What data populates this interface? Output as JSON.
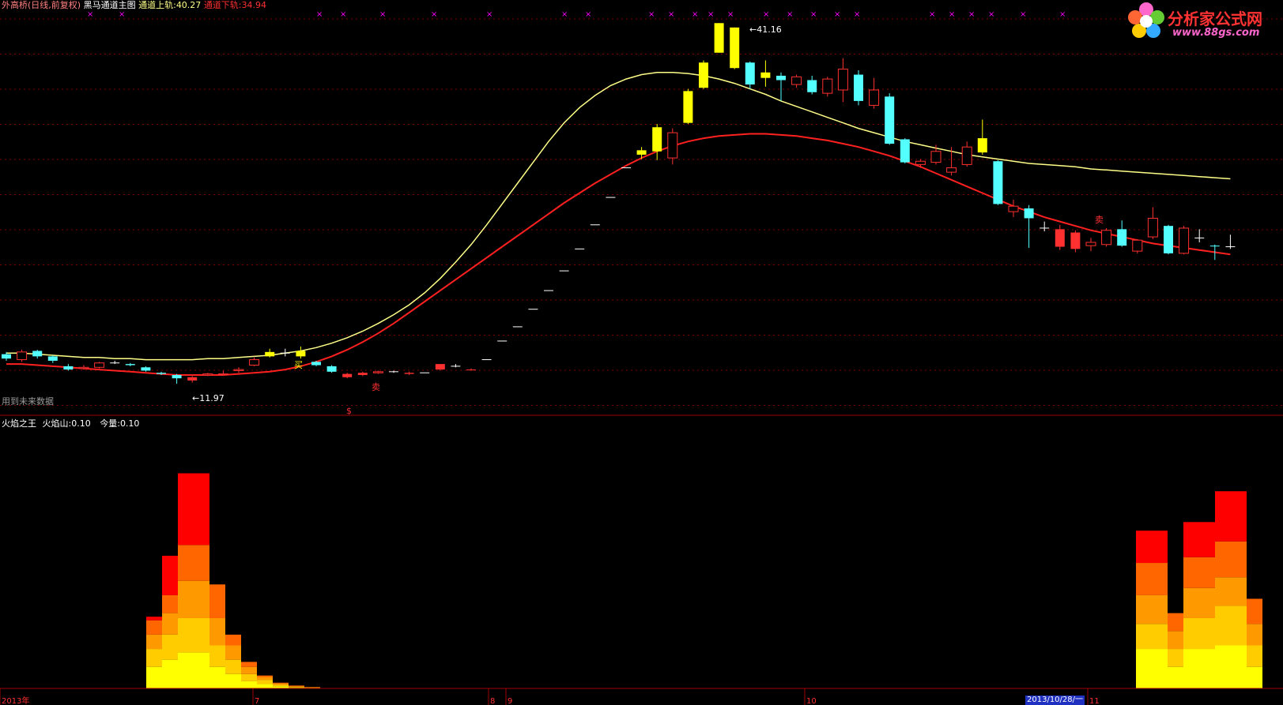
{
  "header": {
    "stock": "外高桥(日线,前复权)",
    "indicator": "黑马通道主图",
    "upper_label": "通道上轨:",
    "upper_value": "40.27",
    "lower_label": "通道下轨:",
    "lower_value": "34.94",
    "future_note": "用到未来数据"
  },
  "subheader": {
    "title": "火焰之王",
    "flame_label": "火焰山:",
    "flame_value": "0.10",
    "vol_label": "今量:",
    "vol_value": "0.10"
  },
  "logo": {
    "title": "分析家公式网",
    "url": "www.88gs.com"
  },
  "annotations": {
    "low_price": "←11.97",
    "high_price": "←41.16",
    "buy_mark": "买",
    "sell_mark": "卖",
    "dollar_mark": "$"
  },
  "x_axis": {
    "labels": [
      "2013年",
      "7",
      "8",
      "9",
      "10",
      "11"
    ],
    "cursor_date": "2013/10/28/一"
  },
  "colors": {
    "background": "#000000",
    "upper_band": "#ffff88",
    "lower_band": "#ff2020",
    "candle_up_red": "#ff3030",
    "candle_down_cyan": "#54ffff",
    "candle_signal_yellow": "#ffff00",
    "grid": "#800000",
    "marker": "#ff00ff"
  },
  "chart_data": [
    {
      "type": "candlestick",
      "title": "黑马通道主图",
      "candles": [
        {
          "o": 12.7,
          "c": 12.3,
          "h": 12.9,
          "l": 12.1,
          "kind": "down"
        },
        {
          "o": 12.2,
          "c": 12.9,
          "h": 13.1,
          "l": 12.0,
          "kind": "up"
        },
        {
          "o": 13.0,
          "c": 12.5,
          "h": 13.1,
          "l": 12.3,
          "kind": "down"
        },
        {
          "o": 12.5,
          "c": 12.1,
          "h": 12.6,
          "l": 11.9,
          "kind": "down"
        },
        {
          "o": 11.6,
          "c": 11.3,
          "h": 11.8,
          "l": 11.2,
          "kind": "down"
        },
        {
          "o": 11.4,
          "c": 11.5,
          "h": 11.7,
          "l": 11.3,
          "kind": "up"
        },
        {
          "o": 11.5,
          "c": 11.9,
          "h": 12.0,
          "l": 11.4,
          "kind": "up"
        },
        {
          "o": 11.9,
          "c": 11.9,
          "h": 12.1,
          "l": 11.8,
          "kind": "doji"
        },
        {
          "o": 11.8,
          "c": 11.7,
          "h": 11.9,
          "l": 11.6,
          "kind": "down"
        },
        {
          "o": 11.5,
          "c": 11.2,
          "h": 11.6,
          "l": 11.1,
          "kind": "down"
        },
        {
          "o": 11.0,
          "c": 10.9,
          "h": 11.1,
          "l": 10.8,
          "kind": "down"
        },
        {
          "o": 10.8,
          "c": 10.5,
          "h": 10.9,
          "l": 10.0,
          "kind": "down"
        },
        {
          "o": 10.6,
          "c": 10.3,
          "h": 10.7,
          "l": 10.1,
          "kind": "redfill"
        },
        {
          "o": 10.8,
          "c": 10.9,
          "h": 11.0,
          "l": 10.7,
          "kind": "up"
        },
        {
          "o": 10.9,
          "c": 10.9,
          "h": 11.2,
          "l": 10.8,
          "kind": "up"
        },
        {
          "o": 11.2,
          "c": 11.3,
          "h": 11.5,
          "l": 11.0,
          "kind": "up"
        },
        {
          "o": 11.7,
          "c": 12.2,
          "h": 12.4,
          "l": 11.6,
          "kind": "up"
        },
        {
          "o": 12.5,
          "c": 12.9,
          "h": 13.2,
          "l": 12.4,
          "kind": "yellow"
        },
        {
          "o": 12.8,
          "c": 12.8,
          "h": 13.2,
          "l": 12.5,
          "kind": "doji"
        },
        {
          "o": 12.5,
          "c": 13.0,
          "h": 13.4,
          "l": 12.3,
          "kind": "yellow"
        },
        {
          "o": 12.0,
          "c": 11.7,
          "h": 12.1,
          "l": 11.6,
          "kind": "down"
        },
        {
          "o": 11.6,
          "c": 11.1,
          "h": 11.7,
          "l": 11.0,
          "kind": "down"
        },
        {
          "o": 10.9,
          "c": 10.6,
          "h": 11.0,
          "l": 10.5,
          "kind": "redfill"
        },
        {
          "o": 10.8,
          "c": 11.0,
          "h": 11.1,
          "l": 10.7,
          "kind": "redfill"
        },
        {
          "o": 11.1,
          "c": 11.0,
          "h": 11.2,
          "l": 10.9,
          "kind": "up"
        },
        {
          "o": 11.1,
          "c": 11.1,
          "h": 11.2,
          "l": 11.0,
          "kind": "doji"
        },
        {
          "o": 11.0,
          "c": 10.9,
          "h": 11.1,
          "l": 10.8,
          "kind": "redfill"
        },
        {
          "o": 11.0,
          "c": 11.0,
          "h": 11.0,
          "l": 11.0,
          "kind": "flat"
        },
        {
          "o": 11.3,
          "c": 11.8,
          "h": 11.8,
          "l": 11.2,
          "kind": "redfill"
        },
        {
          "o": 11.6,
          "c": 11.6,
          "h": 11.8,
          "l": 11.5,
          "kind": "flat"
        },
        {
          "o": 11.3,
          "c": 11.3,
          "h": 11.4,
          "l": 11.2,
          "kind": "redfill"
        },
        {
          "o": 12.2,
          "c": 12.2,
          "h": 12.2,
          "l": 12.2,
          "kind": "flat"
        },
        {
          "o": 13.9,
          "c": 13.9,
          "h": 13.9,
          "l": 13.9,
          "kind": "flat"
        },
        {
          "o": 15.2,
          "c": 15.2,
          "h": 15.2,
          "l": 15.2,
          "kind": "flat"
        },
        {
          "o": 16.8,
          "c": 16.8,
          "h": 16.8,
          "l": 16.8,
          "kind": "flat"
        },
        {
          "o": 18.5,
          "c": 18.5,
          "h": 18.5,
          "l": 18.5,
          "kind": "flat"
        },
        {
          "o": 20.3,
          "c": 20.3,
          "h": 20.3,
          "l": 20.3,
          "kind": "flat"
        },
        {
          "o": 22.3,
          "c": 22.3,
          "h": 22.3,
          "l": 22.3,
          "kind": "flat"
        },
        {
          "o": 24.5,
          "c": 24.5,
          "h": 24.5,
          "l": 24.5,
          "kind": "flat"
        },
        {
          "o": 27.0,
          "c": 27.0,
          "h": 27.0,
          "l": 27.0,
          "kind": "flat"
        },
        {
          "o": 29.7,
          "c": 29.7,
          "h": 29.7,
          "l": 29.7,
          "kind": "flat"
        },
        {
          "o": 30.9,
          "c": 31.3,
          "h": 31.6,
          "l": 30.5,
          "kind": "yellow"
        },
        {
          "o": 31.2,
          "c": 33.4,
          "h": 33.7,
          "l": 30.4,
          "kind": "yellow"
        },
        {
          "o": 30.6,
          "c": 32.9,
          "h": 33.3,
          "l": 30.0,
          "kind": "up"
        },
        {
          "o": 33.8,
          "c": 36.7,
          "h": 36.9,
          "l": 33.7,
          "kind": "yellow"
        },
        {
          "o": 37.0,
          "c": 39.3,
          "h": 39.5,
          "l": 36.9,
          "kind": "yellow"
        },
        {
          "o": 40.2,
          "c": 42.9,
          "h": 42.9,
          "l": 40.2,
          "kind": "yellow"
        },
        {
          "o": 38.8,
          "c": 42.5,
          "h": 42.5,
          "l": 38.7,
          "kind": "yellow"
        },
        {
          "o": 39.3,
          "c": 37.3,
          "h": 39.4,
          "l": 36.9,
          "kind": "down"
        },
        {
          "o": 37.9,
          "c": 38.4,
          "h": 39.5,
          "l": 37.1,
          "kind": "yellow"
        },
        {
          "o": 38.1,
          "c": 37.7,
          "h": 38.4,
          "l": 35.8,
          "kind": "down"
        },
        {
          "o": 37.3,
          "c": 38.0,
          "h": 38.2,
          "l": 37.0,
          "kind": "up"
        },
        {
          "o": 37.7,
          "c": 36.6,
          "h": 38.1,
          "l": 36.4,
          "kind": "down"
        },
        {
          "o": 36.5,
          "c": 37.8,
          "h": 38.0,
          "l": 36.2,
          "kind": "up"
        },
        {
          "o": 36.8,
          "c": 38.7,
          "h": 39.7,
          "l": 35.7,
          "kind": "up"
        },
        {
          "o": 38.2,
          "c": 35.8,
          "h": 38.6,
          "l": 35.4,
          "kind": "down"
        },
        {
          "o": 35.4,
          "c": 36.8,
          "h": 37.9,
          "l": 35.1,
          "kind": "up"
        },
        {
          "o": 36.2,
          "c": 31.9,
          "h": 36.5,
          "l": 31.8,
          "kind": "down"
        },
        {
          "o": 32.3,
          "c": 30.2,
          "h": 32.4,
          "l": 30.1,
          "kind": "down"
        },
        {
          "o": 30.0,
          "c": 30.3,
          "h": 30.5,
          "l": 29.7,
          "kind": "up"
        },
        {
          "o": 30.2,
          "c": 31.2,
          "h": 31.8,
          "l": 30.0,
          "kind": "up"
        },
        {
          "o": 29.3,
          "c": 29.7,
          "h": 31.6,
          "l": 29.0,
          "kind": "up"
        },
        {
          "o": 30.0,
          "c": 31.6,
          "h": 32.1,
          "l": 29.8,
          "kind": "up"
        },
        {
          "o": 32.4,
          "c": 31.1,
          "h": 34.1,
          "l": 30.9,
          "kind": "yellow"
        },
        {
          "o": 30.3,
          "c": 26.4,
          "h": 30.4,
          "l": 26.3,
          "kind": "down"
        },
        {
          "o": 25.7,
          "c": 26.2,
          "h": 26.8,
          "l": 25.2,
          "kind": "up"
        },
        {
          "o": 26.0,
          "c": 25.1,
          "h": 26.3,
          "l": 22.4,
          "kind": "down"
        },
        {
          "o": 24.2,
          "c": 24.2,
          "h": 24.8,
          "l": 23.9,
          "kind": "doji"
        },
        {
          "o": 24.1,
          "c": 22.5,
          "h": 24.5,
          "l": 22.2,
          "kind": "redfill"
        },
        {
          "o": 23.8,
          "c": 22.3,
          "h": 24.0,
          "l": 22.0,
          "kind": "redfill"
        },
        {
          "o": 22.6,
          "c": 22.9,
          "h": 23.3,
          "l": 22.1,
          "kind": "up"
        },
        {
          "o": 22.7,
          "c": 24.0,
          "h": 24.2,
          "l": 22.5,
          "kind": "up"
        },
        {
          "o": 24.1,
          "c": 22.6,
          "h": 24.9,
          "l": 22.5,
          "kind": "down"
        },
        {
          "o": 22.1,
          "c": 23.1,
          "h": 23.2,
          "l": 21.9,
          "kind": "up"
        },
        {
          "o": 23.4,
          "c": 25.1,
          "h": 26.1,
          "l": 23.2,
          "kind": "up"
        },
        {
          "o": 24.4,
          "c": 21.9,
          "h": 24.5,
          "l": 21.8,
          "kind": "down"
        },
        {
          "o": 21.9,
          "c": 24.2,
          "h": 24.4,
          "l": 21.8,
          "kind": "up"
        },
        {
          "o": 23.3,
          "c": 23.3,
          "h": 24.1,
          "l": 22.9,
          "kind": "doji"
        },
        {
          "o": 22.6,
          "c": 22.6,
          "h": 22.7,
          "l": 21.3,
          "kind": "down"
        },
        {
          "o": 22.5,
          "c": 22.5,
          "h": 23.6,
          "l": 22.3,
          "kind": "doji"
        }
      ],
      "upper_band": [
        12.8,
        12.8,
        12.7,
        12.6,
        12.5,
        12.4,
        12.4,
        12.3,
        12.3,
        12.2,
        12.2,
        12.2,
        12.2,
        12.3,
        12.3,
        12.4,
        12.5,
        12.6,
        12.8,
        13.0,
        13.3,
        13.7,
        14.2,
        14.8,
        15.5,
        16.3,
        17.2,
        18.3,
        19.6,
        21.1,
        22.7,
        24.5,
        26.4,
        28.3,
        30.2,
        32.1,
        33.8,
        35.2,
        36.3,
        37.2,
        37.8,
        38.2,
        38.4,
        38.4,
        38.3,
        38.1,
        37.8,
        37.4,
        36.9,
        36.4,
        35.8,
        35.3,
        34.8,
        34.3,
        33.8,
        33.3,
        32.9,
        32.5,
        32.1,
        31.8,
        31.5,
        31.2,
        30.9,
        30.7,
        30.5,
        30.3,
        30.1,
        30.0,
        29.9,
        29.8,
        29.6,
        29.5,
        29.4,
        29.3,
        29.2,
        29.1,
        29.0,
        28.9,
        28.8,
        28.7
      ],
      "lower_band": [
        11.8,
        11.8,
        11.7,
        11.6,
        11.5,
        11.4,
        11.3,
        11.2,
        11.1,
        11.0,
        10.9,
        10.8,
        10.8,
        10.8,
        10.8,
        10.9,
        11.0,
        11.1,
        11.3,
        11.6,
        12.0,
        12.5,
        13.1,
        13.8,
        14.6,
        15.5,
        16.5,
        17.5,
        18.5,
        19.5,
        20.5,
        21.5,
        22.5,
        23.5,
        24.5,
        25.5,
        26.5,
        27.4,
        28.3,
        29.1,
        29.9,
        30.6,
        31.2,
        31.7,
        32.1,
        32.4,
        32.6,
        32.7,
        32.8,
        32.8,
        32.7,
        32.6,
        32.4,
        32.2,
        31.9,
        31.6,
        31.2,
        30.8,
        30.3,
        29.8,
        29.2,
        28.6,
        28.0,
        27.4,
        26.8,
        26.2,
        25.7,
        25.2,
        24.8,
        24.4,
        24.0,
        23.7,
        23.4,
        23.1,
        22.8,
        22.6,
        22.4,
        22.2,
        22.0,
        21.8
      ],
      "ylim": [
        9.0,
        44.0
      ]
    },
    {
      "type": "bar",
      "title": "火焰之王",
      "series": [
        {
          "name": "火焰山",
          "values": []
        },
        {
          "name": "今量",
          "values": []
        }
      ],
      "layers_note_free": true,
      "bars": [
        {
          "x": 185,
          "w": 20,
          "layers": [
            0.3,
            0.55,
            0.75,
            0.95,
            1.0
          ]
        },
        {
          "x": 205,
          "w": 20,
          "layers": [
            0.4,
            0.75,
            1.05,
            1.3,
            1.85
          ]
        },
        {
          "x": 225,
          "w": 40,
          "layers": [
            0.5,
            0.98,
            1.5,
            2.0,
            3.0
          ]
        },
        {
          "x": 265,
          "w": 20,
          "layers": [
            0.3,
            0.6,
            0.98,
            1.45,
            1.45
          ]
        },
        {
          "x": 285,
          "w": 20,
          "layers": [
            0.2,
            0.4,
            0.6,
            0.75,
            0.75
          ]
        },
        {
          "x": 305,
          "w": 20,
          "layers": [
            0.1,
            0.2,
            0.3,
            0.37,
            0.37
          ]
        },
        {
          "x": 325,
          "w": 20,
          "layers": [
            0.06,
            0.12,
            0.16,
            0.18,
            0.18
          ]
        },
        {
          "x": 345,
          "w": 20,
          "layers": [
            0.03,
            0.05,
            0.07,
            0.08,
            0.08
          ]
        },
        {
          "x": 365,
          "w": 20,
          "layers": [
            0.01,
            0.02,
            0.03,
            0.04,
            0.04
          ]
        },
        {
          "x": 385,
          "w": 20,
          "layers": [
            0.005,
            0.01,
            0.015,
            0.02,
            0.02
          ]
        },
        {
          "x": 1437,
          "w": 40,
          "layers": [
            0.55,
            0.9,
            1.3,
            1.75,
            2.2
          ]
        },
        {
          "x": 1477,
          "w": 20,
          "layers": [
            0.3,
            0.55,
            0.8,
            1.05,
            1.05
          ]
        },
        {
          "x": 1497,
          "w": 40,
          "layers": [
            0.55,
            0.98,
            1.4,
            1.83,
            2.32
          ]
        },
        {
          "x": 1537,
          "w": 40,
          "layers": [
            0.6,
            1.15,
            1.55,
            2.05,
            2.75
          ]
        },
        {
          "x": 1577,
          "w": 20,
          "layers": [
            0.3,
            0.6,
            0.9,
            1.25,
            1.25
          ]
        }
      ],
      "ylim": [
        0,
        3.6
      ]
    }
  ]
}
